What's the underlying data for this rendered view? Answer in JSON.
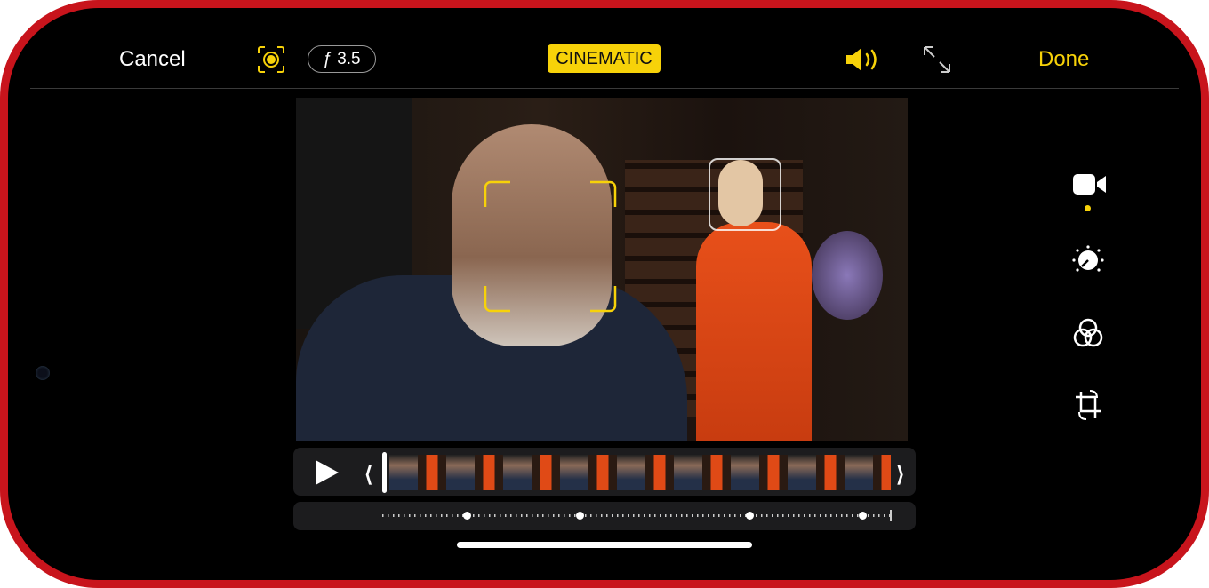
{
  "toolbar": {
    "cancel_label": "Cancel",
    "aperture_label": "ƒ 3.5",
    "mode_label": "CINEMATIC",
    "done_label": "Done"
  },
  "icons": {
    "focus": "focus-lock-icon",
    "audio": "speaker-icon",
    "expand": "expand-icon",
    "video": "video-camera-icon",
    "adjust": "adjust-dial-icon",
    "filters": "filters-icon",
    "crop": "crop-rotate-icon",
    "play": "play-icon"
  },
  "colors": {
    "accent": "#f7d209",
    "frame": "#c8141c",
    "panel": "#1c1c1e"
  },
  "timeline": {
    "focus_point_count": 4
  }
}
